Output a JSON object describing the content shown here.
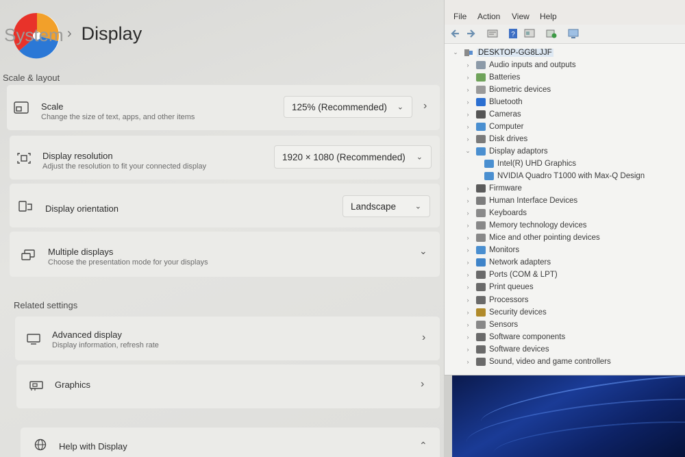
{
  "settings": {
    "breadcrumb_parent": "System",
    "breadcrumb_sep": "›",
    "page_title": "Display",
    "section_scale_layout": "Scale & layout",
    "scale": {
      "label": "Scale",
      "desc": "Change the size of text, apps, and other items",
      "value": "125% (Recommended)"
    },
    "resolution": {
      "label": "Display resolution",
      "desc": "Adjust the resolution to fit your connected display",
      "value": "1920 × 1080 (Recommended)"
    },
    "orientation": {
      "label": "Display orientation",
      "value": "Landscape"
    },
    "multiple": {
      "label": "Multiple displays",
      "desc": "Choose the presentation mode for your displays"
    },
    "section_related": "Related settings",
    "advanced": {
      "label": "Advanced display",
      "desc": "Display information, refresh rate"
    },
    "graphics": {
      "label": "Graphics"
    },
    "help": {
      "label": "Help with Display"
    }
  },
  "device_manager": {
    "menu": [
      "File",
      "Action",
      "View",
      "Help"
    ],
    "computer_name": "DESKTOP-GG8LJJF",
    "categories": [
      {
        "label": "Audio inputs and outputs",
        "icon": "speaker-icon",
        "color": "#8c9aa8"
      },
      {
        "label": "Batteries",
        "icon": "battery-icon",
        "color": "#6fa35a"
      },
      {
        "label": "Biometric devices",
        "icon": "fingerprint-icon",
        "color": "#9a9a9a"
      },
      {
        "label": "Bluetooth",
        "icon": "bluetooth-icon",
        "color": "#2b6fd1"
      },
      {
        "label": "Cameras",
        "icon": "camera-icon",
        "color": "#555555"
      },
      {
        "label": "Computer",
        "icon": "computer-icon",
        "color": "#4a8fd0"
      },
      {
        "label": "Disk drives",
        "icon": "disk-icon",
        "color": "#7a7a7a"
      },
      {
        "label": "Display adaptors",
        "icon": "display-icon",
        "color": "#4a8fd0",
        "expanded": true,
        "children": [
          "Intel(R) UHD Graphics",
          "NVIDIA Quadro T1000 with Max-Q Design"
        ]
      },
      {
        "label": "Firmware",
        "icon": "firmware-icon",
        "color": "#5b5b5b"
      },
      {
        "label": "Human Interface Devices",
        "icon": "hid-icon",
        "color": "#7d7d7d"
      },
      {
        "label": "Keyboards",
        "icon": "keyboard-icon",
        "color": "#8a8a8a"
      },
      {
        "label": "Memory technology devices",
        "icon": "memory-icon",
        "color": "#888888"
      },
      {
        "label": "Mice and other pointing devices",
        "icon": "mouse-icon",
        "color": "#888888"
      },
      {
        "label": "Monitors",
        "icon": "monitor-icon",
        "color": "#4a8fd0"
      },
      {
        "label": "Network adapters",
        "icon": "network-icon",
        "color": "#3f84c9"
      },
      {
        "label": "Ports (COM & LPT)",
        "icon": "port-icon",
        "color": "#6a6a6a"
      },
      {
        "label": "Print queues",
        "icon": "printer-icon",
        "color": "#6a6a6a"
      },
      {
        "label": "Processors",
        "icon": "processor-icon",
        "color": "#6a6a6a"
      },
      {
        "label": "Security devices",
        "icon": "security-icon",
        "color": "#b08a2a"
      },
      {
        "label": "Sensors",
        "icon": "sensor-icon",
        "color": "#888888"
      },
      {
        "label": "Software components",
        "icon": "software-icon",
        "color": "#6a6a6a"
      },
      {
        "label": "Software devices",
        "icon": "software-device-icon",
        "color": "#6a6a6a"
      },
      {
        "label": "Sound, video and game controllers",
        "icon": "sound-icon",
        "color": "#6a6a6a"
      }
    ]
  },
  "colors": {
    "accent_blue": "#1f5fd0",
    "logo_red": "#e8322a",
    "logo_orange": "#f2a02a",
    "logo_blue": "#2b78d6"
  }
}
